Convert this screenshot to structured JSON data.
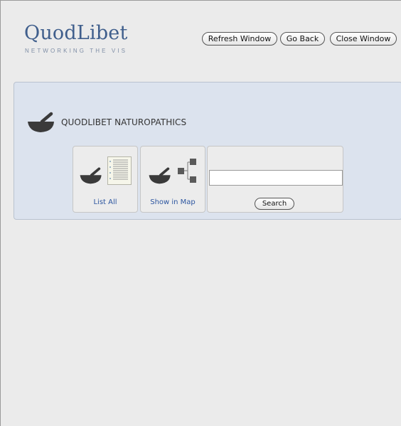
{
  "logo": {
    "title": "QuodLibet",
    "tagline": "NETWORKING THE VIS"
  },
  "toolbar": {
    "refresh_label": "Refresh Window",
    "back_label": "Go Back",
    "close_label": "Close Window"
  },
  "panel": {
    "heading": "QUODLIBET NATUROPATHICS",
    "tiles": [
      {
        "label": "List All",
        "icons": [
          "mortar-pestle-icon",
          "list-document-icon"
        ]
      },
      {
        "label": "Show in Map",
        "icons": [
          "mortar-pestle-icon",
          "tree-map-icon"
        ]
      }
    ],
    "search": {
      "value": "",
      "placeholder": "",
      "button_label": "Search"
    }
  },
  "colors": {
    "logo_blue": "#3f5e8c",
    "link_blue": "#2d56a0",
    "panel_bg": "#dce3ee",
    "icon_dark": "#3a3a3a"
  }
}
